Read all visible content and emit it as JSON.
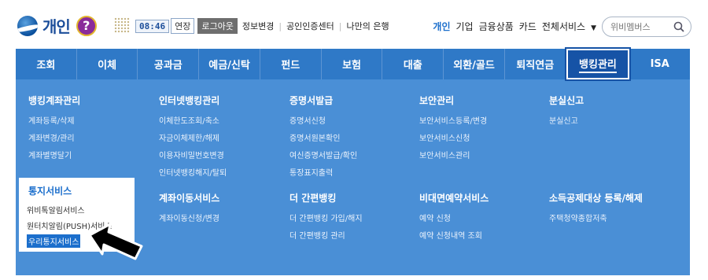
{
  "brand": {
    "name": "개인",
    "help_glyph": "?"
  },
  "session": {
    "timer": "08:46",
    "extend_label": "연장",
    "logout_label": "로그아웃"
  },
  "top_links": [
    "정보변경",
    "공인인증센터",
    "나만의 은행"
  ],
  "top_nav": {
    "items": [
      "개인",
      "기업",
      "금융상품",
      "카드",
      "전체서비스"
    ],
    "active": "개인"
  },
  "search": {
    "placeholder": "위비멤버스"
  },
  "main_nav": {
    "tabs": [
      "조회",
      "이체",
      "공과금",
      "예금/신탁",
      "펀드",
      "보험",
      "대출",
      "외환/골드",
      "퇴직연금",
      "뱅킹관리",
      "ISA"
    ],
    "selected": "뱅킹관리"
  },
  "menu": {
    "columns": [
      {
        "title": "뱅킹계좌관리",
        "items": [
          "계좌등록/삭제",
          "계좌변경/관리",
          "계좌별명달기"
        ]
      },
      {
        "title": "인터넷뱅킹관리",
        "items": [
          "이체한도조회/축소",
          "자금이체제한/해제",
          "이용자비밀번호변경",
          "인터넷뱅킹해지/탈퇴"
        ]
      },
      {
        "title": "증명서발급",
        "items": [
          "증명서신청",
          "증명서원본확인",
          "여신증명서발급/확인",
          "통장표지출력"
        ]
      },
      {
        "title": "보안관리",
        "items": [
          "보안서비스등록/변경",
          "보안서비스신청",
          "보안서비스관리"
        ]
      },
      {
        "title": "분실신고",
        "items": [
          "분실신고"
        ]
      },
      {
        "title": "통지서비스",
        "items": [
          "위비톡알림서비스",
          "원터치알림(PUSH)서비스",
          "우리통지서비스"
        ]
      },
      {
        "title": "계좌이동서비스",
        "items": [
          "계좌이동신청/변경"
        ]
      },
      {
        "title": "더 간편뱅킹",
        "items": [
          "더 간편뱅킹 가입/해지",
          "더 간편뱅킹 관리"
        ]
      },
      {
        "title": "비대면예약서비스",
        "items": [
          "예약 신청",
          "예약 신청내역 조회"
        ]
      },
      {
        "title": "소득공제대상 등록/해제",
        "items": [
          "주택청약종합저축"
        ]
      }
    ],
    "highlighted_item": "우리통지서비스"
  },
  "colors": {
    "nav_blue": "#2f79c7",
    "panel_blue": "#4a8fd6",
    "selected_tab": "#1653a6",
    "accent": "#1c6fcc"
  }
}
